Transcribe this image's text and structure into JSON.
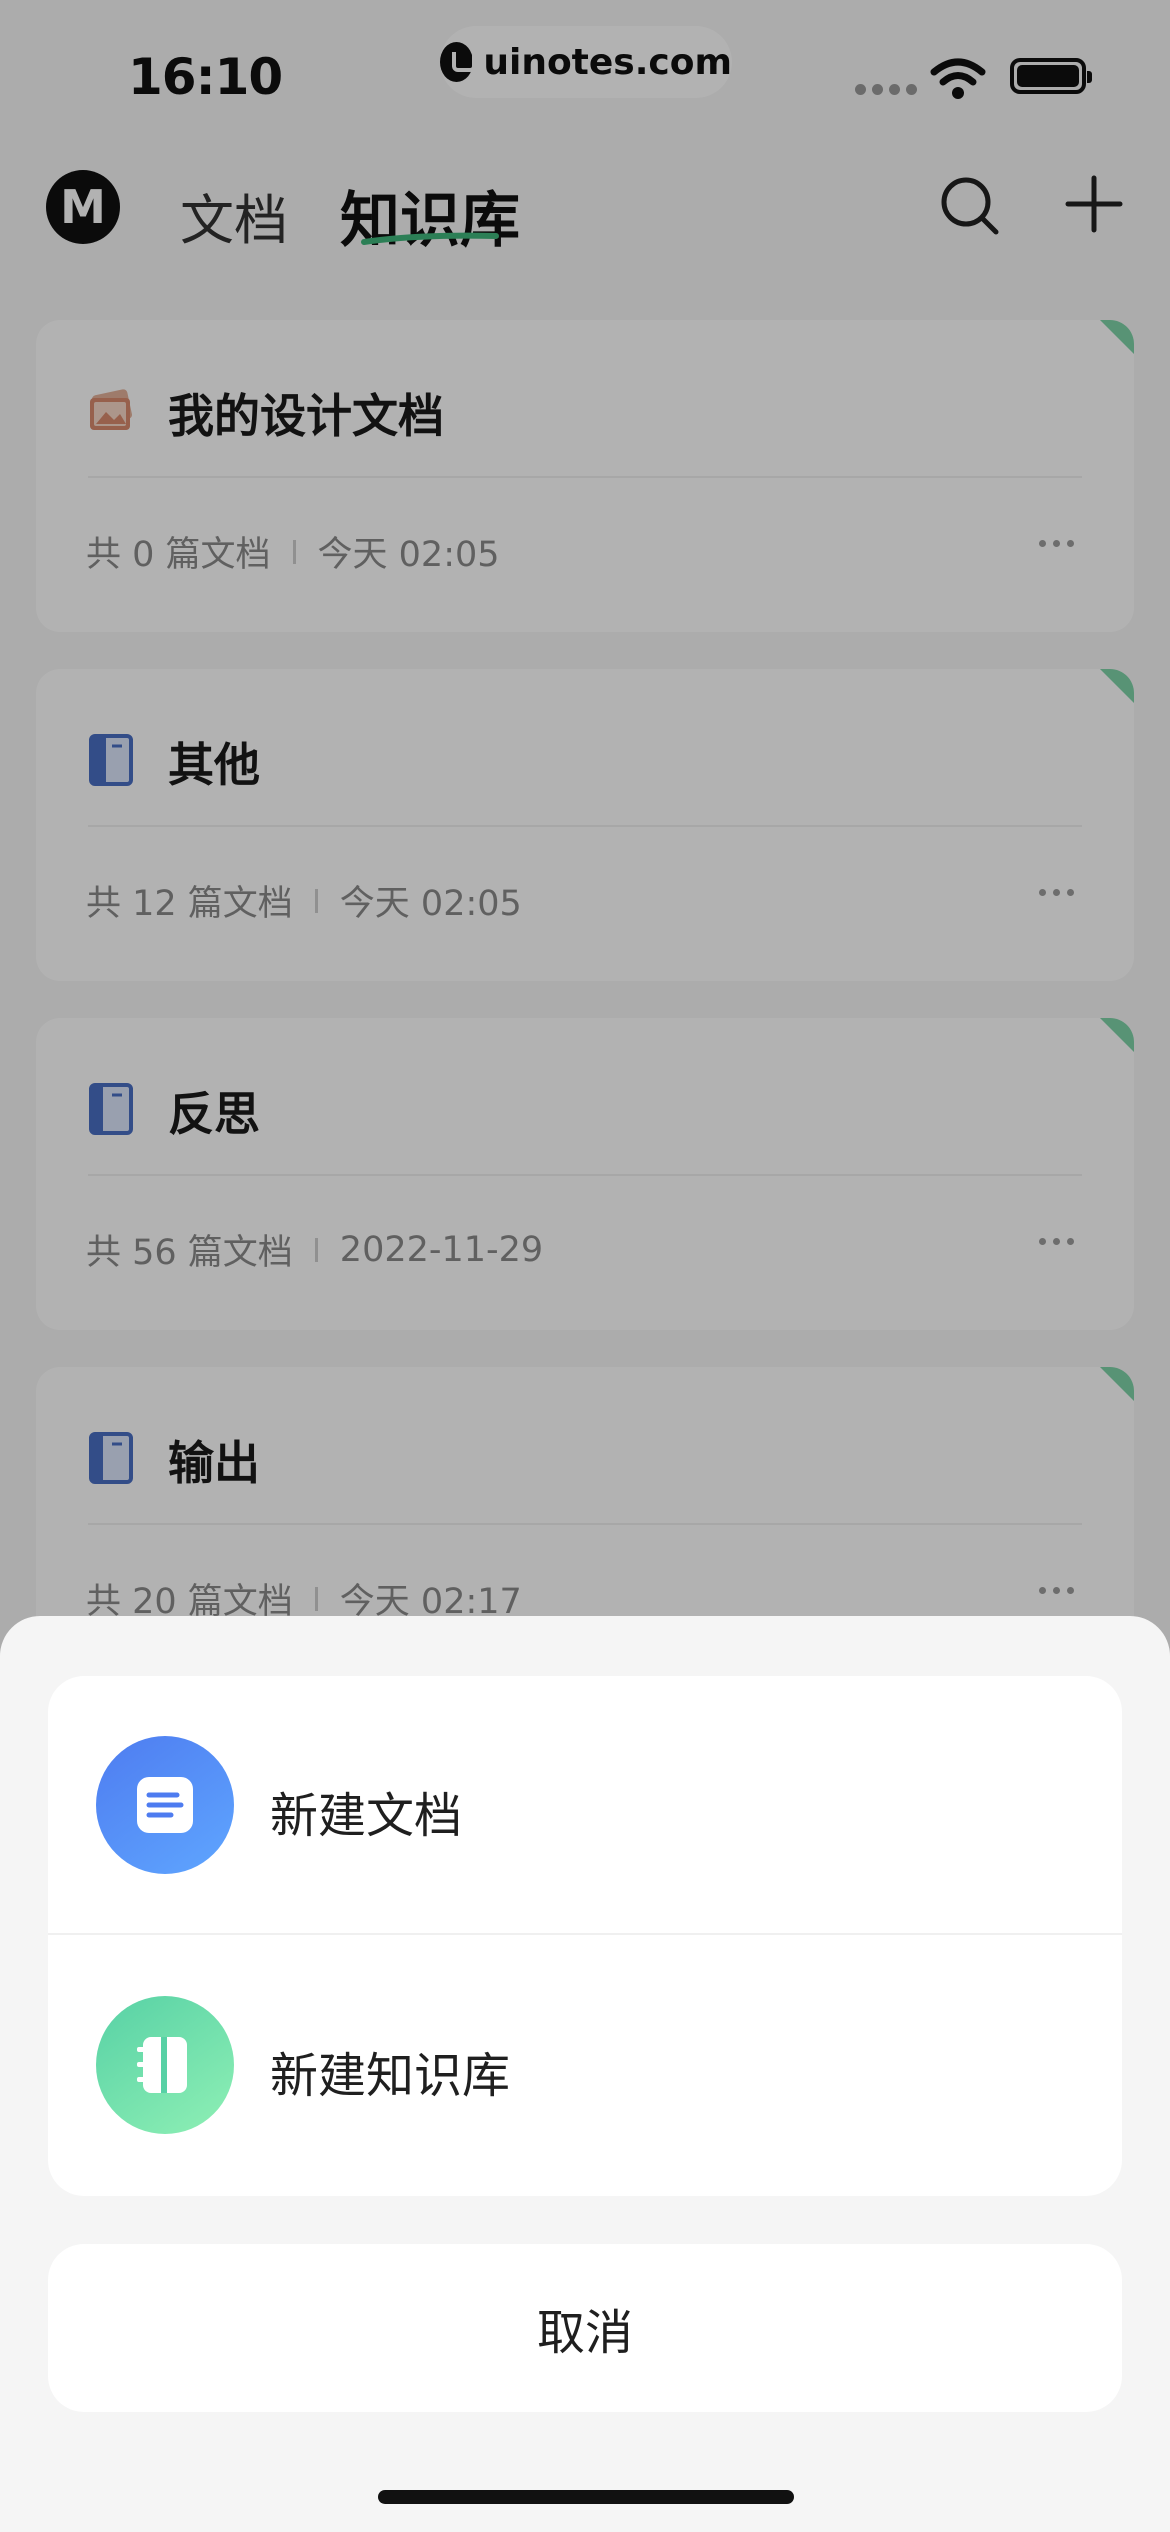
{
  "status_bar": {
    "time": "16:10",
    "watermark": "uinotes.com"
  },
  "header": {
    "logo_letter": "M",
    "tab_docs": "文档",
    "tab_kb": "知识库"
  },
  "cards": [
    {
      "title": "我的设计文档",
      "count": "共 0 篇文档",
      "time": "今天 02:05",
      "icon": "image-album-icon"
    },
    {
      "title": "其他",
      "count": "共 12 篇文档",
      "time": "今天 02:05",
      "icon": "book-icon"
    },
    {
      "title": "反思",
      "count": "共 56 篇文档",
      "time": "2022-11-29",
      "icon": "book-icon"
    },
    {
      "title": "输出",
      "count": "共 20 篇文档",
      "time": "今天 02:17",
      "icon": "book-icon"
    }
  ],
  "sheet": {
    "new_doc": "新建文档",
    "new_kb": "新建知识库",
    "cancel": "取消"
  },
  "colors": {
    "accent_green": "#3fb77b",
    "doc_blue": "#4e7cf0",
    "kb_green": "#57d1a5"
  }
}
